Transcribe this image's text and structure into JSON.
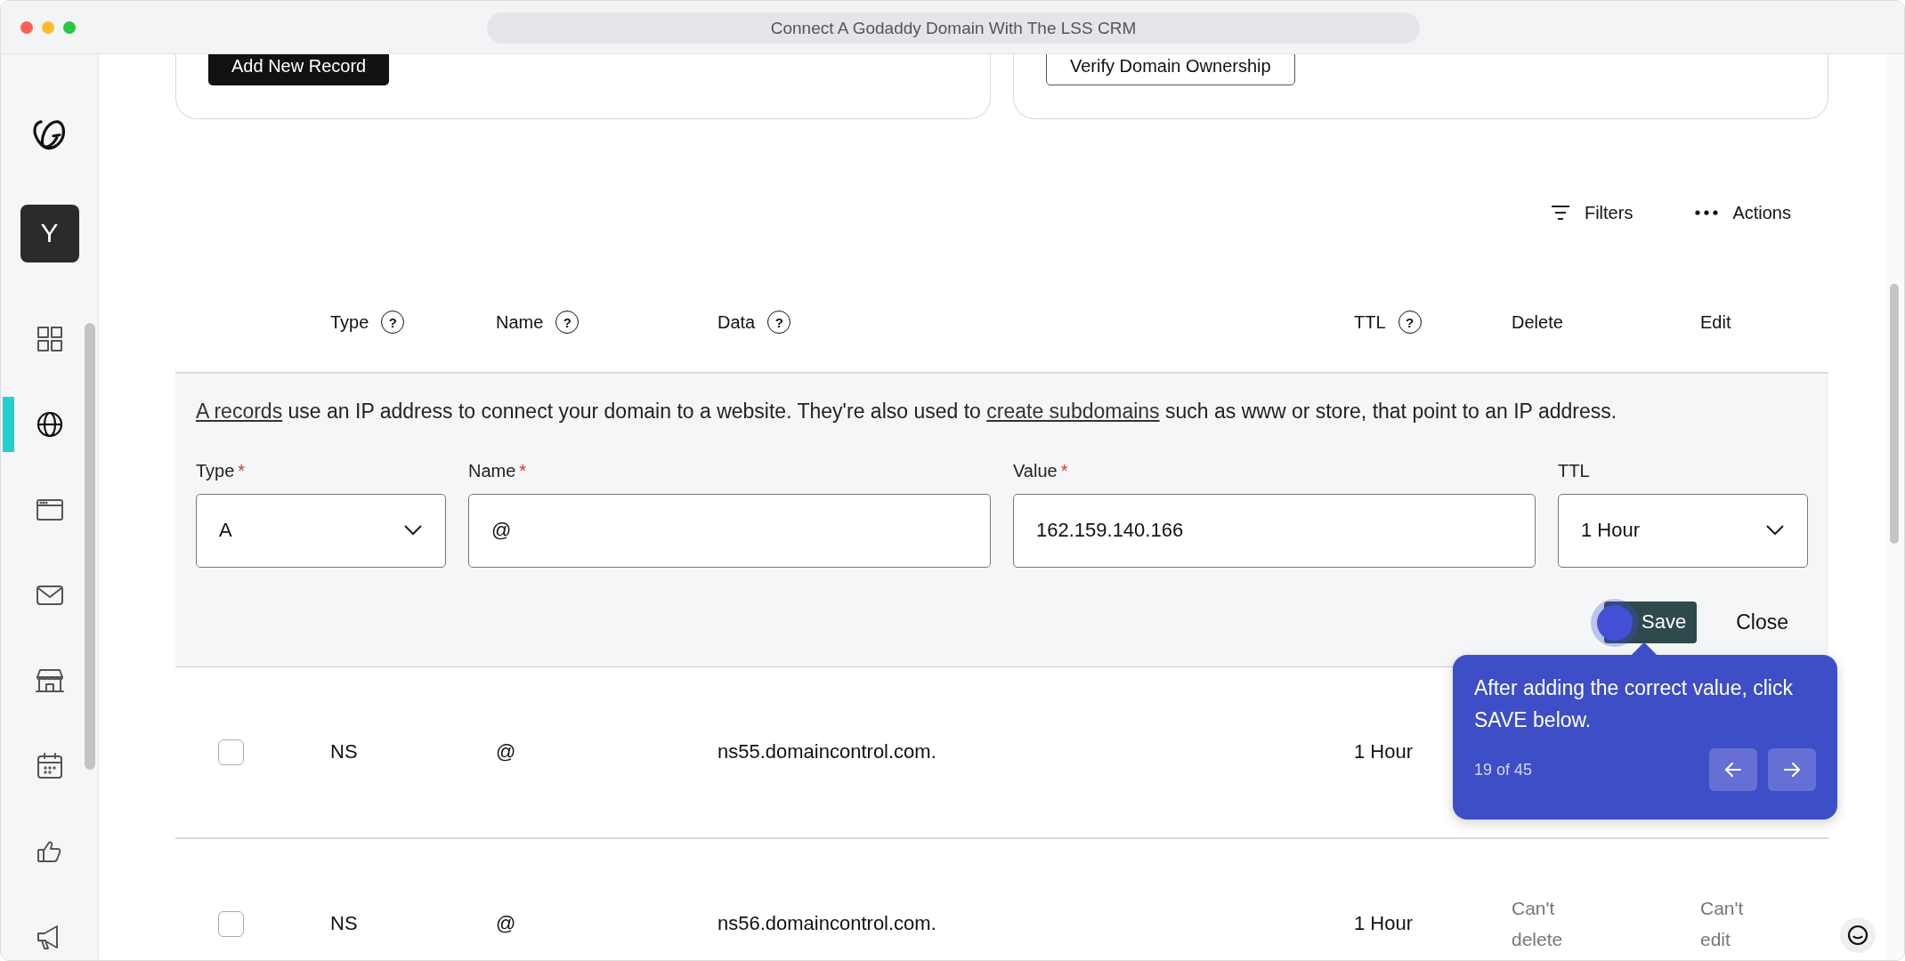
{
  "window": {
    "title": "Connect A Godaddy Domain With The LSS CRM"
  },
  "sidebar": {
    "avatar": "Y",
    "items": [
      {
        "selected": false
      },
      {
        "selected": true
      },
      {
        "selected": false
      },
      {
        "selected": false
      },
      {
        "selected": false
      },
      {
        "selected": false
      },
      {
        "selected": false
      },
      {
        "selected": false
      }
    ]
  },
  "top_cards": [
    {
      "kind": "primary",
      "button": "Add New Record"
    },
    {
      "kind": "outline",
      "button": "Verify Domain Ownership"
    }
  ],
  "toolbar": {
    "filters": "Filters",
    "actions": "Actions"
  },
  "table": {
    "columns": [
      {
        "label": "Type",
        "help": "?"
      },
      {
        "label": "Name",
        "help": "?"
      },
      {
        "label": "Data",
        "help": "?"
      },
      {
        "label": "TTL",
        "help": "?"
      },
      {
        "label": "Delete"
      },
      {
        "label": "Edit"
      }
    ]
  },
  "editor": {
    "description": [
      {
        "text": "A records",
        "link": true
      },
      {
        "text": " use an IP address to connect your domain to a website. They're also used to ",
        "link": false
      },
      {
        "text": "create subdomains",
        "link": true
      },
      {
        "text": " such as www or store, that point to an IP address.",
        "link": false
      }
    ],
    "fields": [
      {
        "kind": "select",
        "label": "Type",
        "required_mark": "*",
        "value": "A"
      },
      {
        "kind": "text",
        "label": "Name",
        "required_mark": "*",
        "value": "@"
      },
      {
        "kind": "text",
        "label": "Value",
        "required_mark": "*",
        "value": "162.159.140.166"
      },
      {
        "kind": "select",
        "label": "TTL",
        "value": "1 Hour"
      }
    ],
    "save": "Save",
    "close": "Close"
  },
  "rows": [
    {
      "checked": false,
      "type": "NS",
      "name": "@",
      "data": "ns55.domaincontrol.com.",
      "ttl": "1 Hour"
    },
    {
      "checked": false,
      "type": "NS",
      "name": "@",
      "data": "ns56.domaincontrol.com.",
      "ttl": "1 Hour",
      "delete": "Can't delete",
      "edit": "Can't edit"
    }
  ],
  "tooltip": {
    "text": "After adding the correct value, click SAVE below.",
    "counter": "19 of 45"
  }
}
